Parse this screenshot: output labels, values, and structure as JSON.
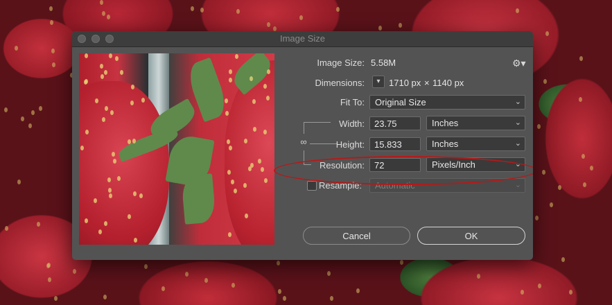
{
  "window": {
    "title": "Image Size"
  },
  "image_size": {
    "label": "Image Size:",
    "value": "5.58M"
  },
  "dimensions": {
    "label": "Dimensions:",
    "width": "1710 px",
    "separator": "×",
    "height": "1140 px"
  },
  "fit_to": {
    "label": "Fit To:",
    "value": "Original Size"
  },
  "width": {
    "label": "Width:",
    "value": "23.75",
    "unit": "Inches"
  },
  "height": {
    "label": "Height:",
    "value": "15.833",
    "unit": "Inches"
  },
  "resolution": {
    "label": "Resolution:",
    "value": "72",
    "unit": "Pixels/Inch"
  },
  "resample": {
    "label": "Resample:",
    "value": "Automatic",
    "checked": false
  },
  "buttons": {
    "cancel": "Cancel",
    "ok": "OK"
  },
  "icons": {
    "gear": "gear-icon",
    "chain": "chain-link-icon",
    "dimension_toggle": "chevron-down-icon"
  },
  "colors": {
    "annotation": "#b81818",
    "dialog_bg": "#535353"
  }
}
